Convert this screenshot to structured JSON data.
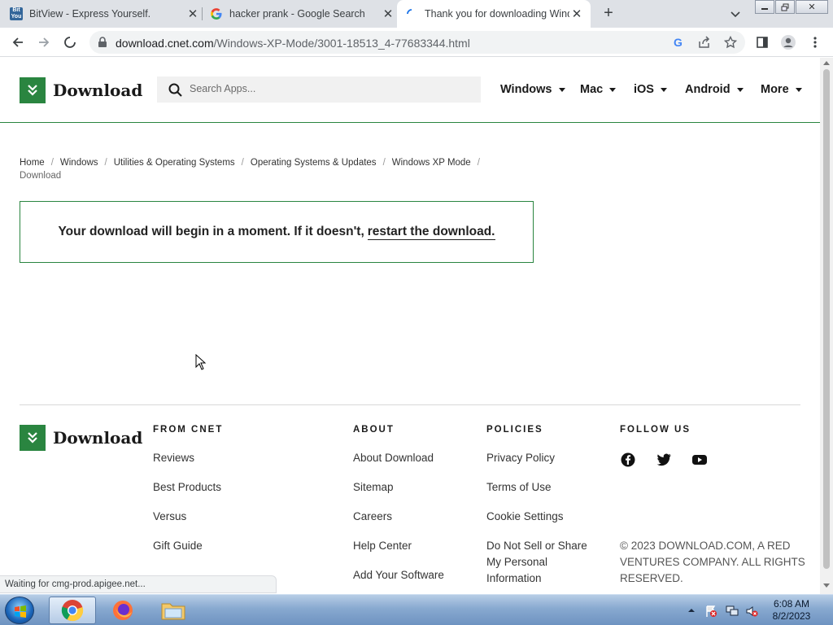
{
  "browser": {
    "tabs": [
      {
        "title": "BitView - Express Yourself."
      },
      {
        "title": "hacker prank - Google Search"
      },
      {
        "title": "Thank you for downloading Windows XP Mode"
      }
    ],
    "url_host": "download.cnet.com",
    "url_path": "/Windows-XP-Mode/3001-18513_4-77683344.html",
    "status_text": "Waiting for cmg-prod.apigee.net..."
  },
  "site": {
    "logo_text": "Download",
    "search_placeholder": "Search Apps...",
    "nav": [
      {
        "label": "Windows"
      },
      {
        "label": "Mac"
      },
      {
        "label": "iOS"
      },
      {
        "label": "Android"
      },
      {
        "label": "More"
      }
    ],
    "breadcrumb": [
      {
        "label": "Home"
      },
      {
        "label": "Windows"
      },
      {
        "label": "Utilities & Operating Systems"
      },
      {
        "label": "Operating Systems & Updates"
      },
      {
        "label": "Windows XP Mode"
      },
      {
        "label": "Download"
      }
    ],
    "notice": {
      "text": "Your download will begin in a moment. If it doesn't,",
      "link": "restart the download."
    }
  },
  "footer": {
    "logo_text": "Download",
    "from_cnet": {
      "heading": "FROM CNET",
      "links": [
        "Reviews",
        "Best Products",
        "Versus",
        "Gift Guide"
      ]
    },
    "about": {
      "heading": "ABOUT",
      "links": [
        "About Download",
        "Sitemap",
        "Careers",
        "Help Center",
        "Add Your Software"
      ]
    },
    "policies": {
      "heading": "POLICIES",
      "links": [
        "Privacy Policy",
        "Terms of Use",
        "Cookie Settings",
        "Do Not Sell or Share My Personal Information"
      ]
    },
    "follow": {
      "heading": "FOLLOW US",
      "icons": [
        "facebook-icon",
        "twitter-icon",
        "youtube-icon"
      ]
    },
    "copyright": "© 2023 DOWNLOAD.COM, A RED VENTURES COMPANY. ALL RIGHTS RESERVED."
  },
  "taskbar": {
    "time": "6:08 AM",
    "date": "8/2/2023"
  },
  "colors": {
    "brand_green": "#2a8540",
    "tab_bg": "#dee1e6"
  }
}
